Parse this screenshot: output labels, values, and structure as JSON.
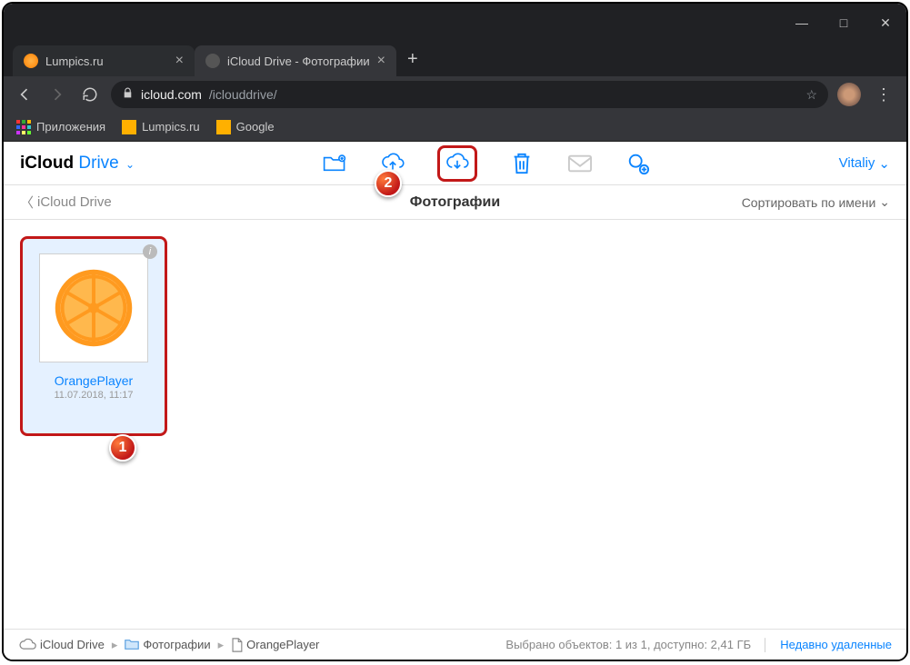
{
  "window": {
    "minimize": "—",
    "maximize": "□",
    "close": "✕"
  },
  "tabs": {
    "t1": {
      "label": "Lumpics.ru"
    },
    "t2": {
      "label": "iCloud Drive - Фотографии"
    },
    "newtab": "+"
  },
  "address": {
    "host": "icloud.com",
    "path": "/iclouddrive/"
  },
  "bookmarks": {
    "apps": "Приложения",
    "b1": "Lumpics.ru",
    "b2": "Google"
  },
  "icloud": {
    "logo_prefix": "iCloud ",
    "logo_drive": "Drive",
    "username": "Vitaliy",
    "back_label": "iCloud Drive",
    "page_title": "Фотографии",
    "sort_label": "Сортировать по имени"
  },
  "file": {
    "name": "OrangePlayer",
    "date": "11.07.2018, 11:17",
    "info": "i"
  },
  "breadcrumb": {
    "root": "iCloud Drive",
    "folder": "Фотографии",
    "file": "OrangePlayer"
  },
  "status": {
    "selection": "Выбрано объектов: 1 из 1, доступно: 2,41 ГБ",
    "trash_link": "Недавно удаленные"
  },
  "annotations": {
    "n1": "1",
    "n2": "2"
  }
}
